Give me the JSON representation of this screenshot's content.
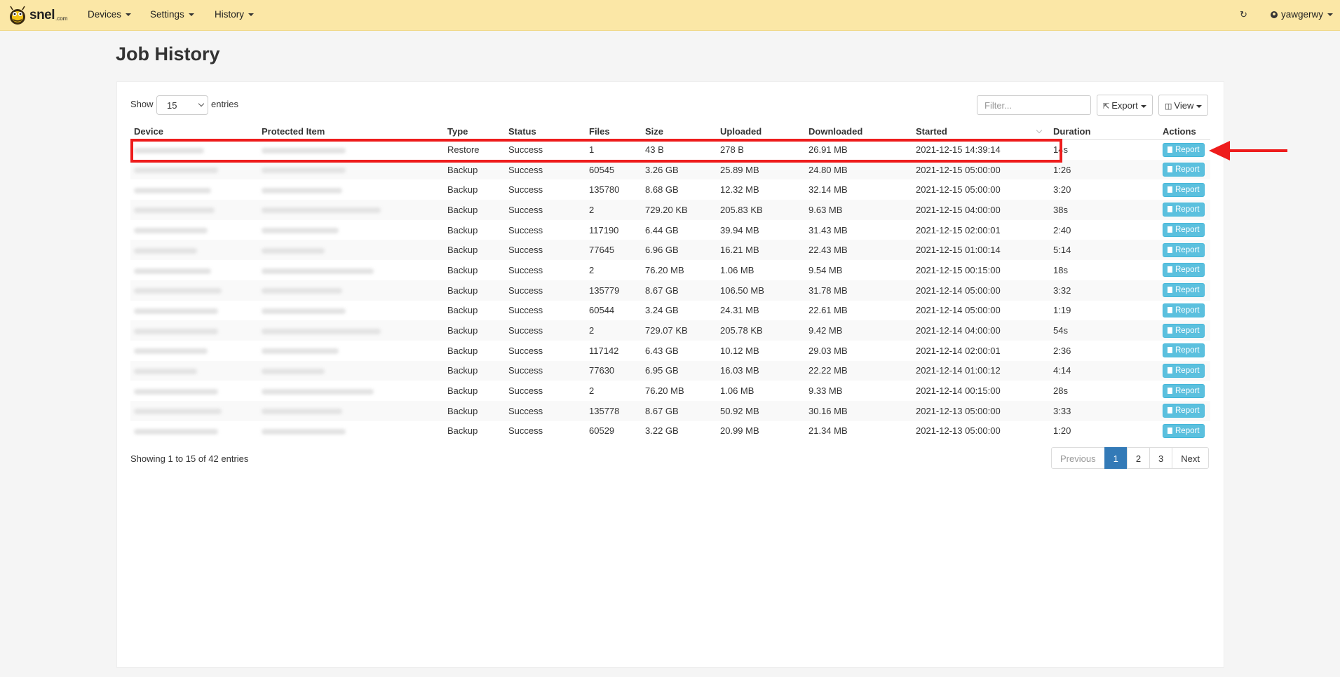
{
  "nav": {
    "logo_text": "snel",
    "logo_sub": ".com",
    "items": [
      "Devices",
      "Settings",
      "History"
    ],
    "refresh_icon": "refresh-icon",
    "user": "yawgerwy"
  },
  "page": {
    "title": "Job History"
  },
  "controls": {
    "show_label": "Show",
    "page_length": "15",
    "entries_label": "entries",
    "filter_placeholder": "Filter...",
    "export_label": "Export",
    "view_label": "View"
  },
  "table": {
    "columns": [
      "Device",
      "Protected Item",
      "Type",
      "Status",
      "Files",
      "Size",
      "Uploaded",
      "Downloaded",
      "Started",
      "Duration",
      "Actions"
    ],
    "rows": [
      {
        "type": "Restore",
        "status": "Success",
        "files": "1",
        "size": "43 B",
        "uploaded": "278 B",
        "downloaded": "26.91 MB",
        "started": "2021-12-15 14:39:14",
        "duration": "14s"
      },
      {
        "type": "Backup",
        "status": "Success",
        "files": "60545",
        "size": "3.26 GB",
        "uploaded": "25.89 MB",
        "downloaded": "24.80 MB",
        "started": "2021-12-15 05:00:00",
        "duration": "1:26"
      },
      {
        "type": "Backup",
        "status": "Success",
        "files": "135780",
        "size": "8.68 GB",
        "uploaded": "12.32 MB",
        "downloaded": "32.14 MB",
        "started": "2021-12-15 05:00:00",
        "duration": "3:20"
      },
      {
        "type": "Backup",
        "status": "Success",
        "files": "2",
        "size": "729.20 KB",
        "uploaded": "205.83 KB",
        "downloaded": "9.63 MB",
        "started": "2021-12-15 04:00:00",
        "duration": "38s"
      },
      {
        "type": "Backup",
        "status": "Success",
        "files": "117190",
        "size": "6.44 GB",
        "uploaded": "39.94 MB",
        "downloaded": "31.43 MB",
        "started": "2021-12-15 02:00:01",
        "duration": "2:40"
      },
      {
        "type": "Backup",
        "status": "Success",
        "files": "77645",
        "size": "6.96 GB",
        "uploaded": "16.21 MB",
        "downloaded": "22.43 MB",
        "started": "2021-12-15 01:00:14",
        "duration": "5:14"
      },
      {
        "type": "Backup",
        "status": "Success",
        "files": "2",
        "size": "76.20 MB",
        "uploaded": "1.06 MB",
        "downloaded": "9.54 MB",
        "started": "2021-12-15 00:15:00",
        "duration": "18s"
      },
      {
        "type": "Backup",
        "status": "Success",
        "files": "135779",
        "size": "8.67 GB",
        "uploaded": "106.50 MB",
        "downloaded": "31.78 MB",
        "started": "2021-12-14 05:00:00",
        "duration": "3:32"
      },
      {
        "type": "Backup",
        "status": "Success",
        "files": "60544",
        "size": "3.24 GB",
        "uploaded": "24.31 MB",
        "downloaded": "22.61 MB",
        "started": "2021-12-14 05:00:00",
        "duration": "1:19"
      },
      {
        "type": "Backup",
        "status": "Success",
        "files": "2",
        "size": "729.07 KB",
        "uploaded": "205.78 KB",
        "downloaded": "9.42 MB",
        "started": "2021-12-14 04:00:00",
        "duration": "54s"
      },
      {
        "type": "Backup",
        "status": "Success",
        "files": "117142",
        "size": "6.43 GB",
        "uploaded": "10.12 MB",
        "downloaded": "29.03 MB",
        "started": "2021-12-14 02:00:01",
        "duration": "2:36"
      },
      {
        "type": "Backup",
        "status": "Success",
        "files": "77630",
        "size": "6.95 GB",
        "uploaded": "16.03 MB",
        "downloaded": "22.22 MB",
        "started": "2021-12-14 01:00:12",
        "duration": "4:14"
      },
      {
        "type": "Backup",
        "status": "Success",
        "files": "2",
        "size": "76.20 MB",
        "uploaded": "1.06 MB",
        "downloaded": "9.33 MB",
        "started": "2021-12-14 00:15:00",
        "duration": "28s"
      },
      {
        "type": "Backup",
        "status": "Success",
        "files": "135778",
        "size": "8.67 GB",
        "uploaded": "50.92 MB",
        "downloaded": "30.16 MB",
        "started": "2021-12-13 05:00:00",
        "duration": "3:33"
      },
      {
        "type": "Backup",
        "status": "Success",
        "files": "60529",
        "size": "3.22 GB",
        "uploaded": "20.99 MB",
        "downloaded": "21.34 MB",
        "started": "2021-12-13 05:00:00",
        "duration": "1:20"
      }
    ],
    "action_label": "Report",
    "action_icon": "document-icon"
  },
  "footer": {
    "info": "Showing 1 to 15 of 42 entries",
    "pagination": [
      "Previous",
      "1",
      "2",
      "3",
      "Next"
    ]
  },
  "colors": {
    "navbar": "#fbe7a6",
    "success": "#2a7d14",
    "report_button": "#5bc0de",
    "active_page": "#337ab7",
    "annotation": "#ee1c1c"
  }
}
